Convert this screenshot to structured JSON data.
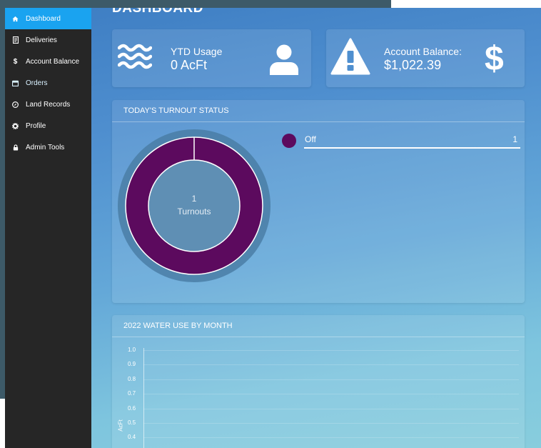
{
  "sidebar": {
    "items": [
      {
        "label": "Dashboard",
        "icon": "home-icon",
        "active": true
      },
      {
        "label": "Deliveries",
        "icon": "document-icon"
      },
      {
        "label": "Account Balance",
        "icon": "dollar-icon"
      },
      {
        "label": "Orders",
        "icon": "calendar-icon"
      },
      {
        "label": "Land Records",
        "icon": "compass-icon"
      },
      {
        "label": "Profile",
        "icon": "gear-icon"
      },
      {
        "label": "Admin Tools",
        "icon": "lock-icon"
      }
    ]
  },
  "page": {
    "title": "DASHBOARD"
  },
  "usage_card": {
    "label": "YTD Usage",
    "value": "0 AcFt",
    "icon": "water-waves-icon",
    "icon2": "user-icon"
  },
  "balance_card": {
    "label": "Account Balance:",
    "value": "$1,022.39",
    "icon": "warning-icon",
    "icon2": "dollar-sign-icon"
  },
  "turnout_panel": {
    "title": "TODAY'S TURNOUT STATUS",
    "center_count": "1",
    "center_label": "Turnouts",
    "legend": [
      {
        "name": "Off",
        "count": "1",
        "color": "#5c0a5e"
      }
    ]
  },
  "water_panel": {
    "title": "2022 WATER USE BY MONTH",
    "ylabel": "AcFt"
  },
  "chart_data": {
    "type": "bar",
    "title": "2022 WATER USE BY MONTH",
    "ylabel": "AcFt",
    "ytick_labels": [
      "1.0",
      "0.9",
      "0.8",
      "0.7",
      "0.6",
      "0.5",
      "0.4"
    ],
    "ylim": [
      0,
      1.0
    ],
    "grid": true,
    "series": [
      {
        "values": []
      }
    ]
  },
  "colors": {
    "accent": "#1aa3f0",
    "sidebar": "#262626",
    "donut": "#5c0a5e"
  }
}
